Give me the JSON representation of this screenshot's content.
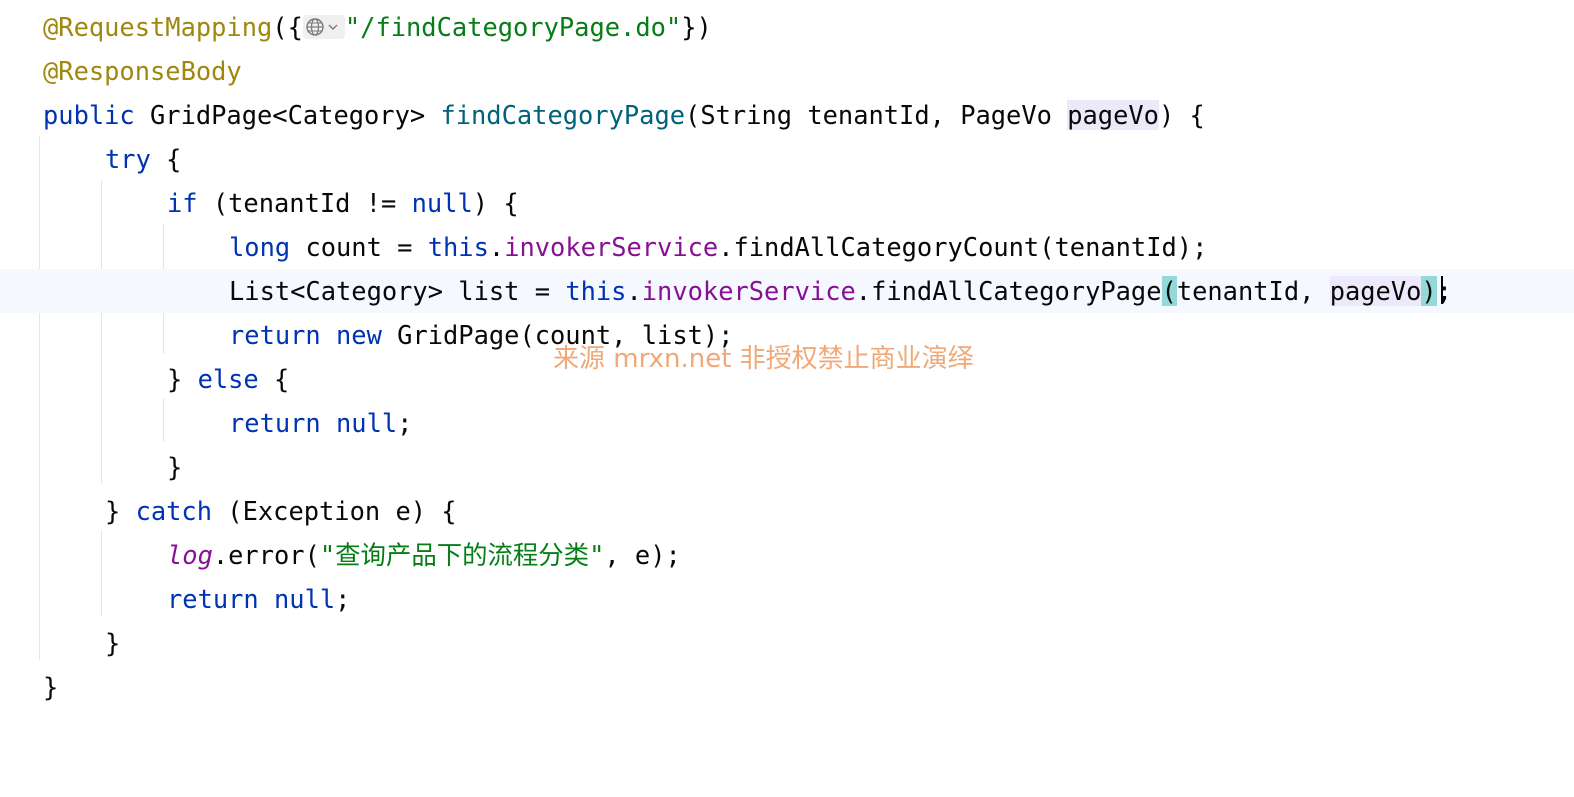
{
  "editor": {
    "lines": [
      {
        "a": "@RequestMapping",
        "b": "({",
        "c": "\"/findCategoryPage.do\"",
        "d": "})"
      },
      {
        "a": "@ResponseBody"
      },
      {
        "kw": "public",
        "b": " GridPage<Category> ",
        "fn": "findCategoryPage",
        "c": "(String tenantId, PageVo ",
        "hl": "pageVo",
        "d": ") {"
      },
      {
        "kw": "try",
        "b": " {"
      },
      {
        "kw": "if",
        "b": " (tenantId != ",
        "kw2": "null",
        "c": ") {"
      },
      {
        "kw": "long",
        "b": " count = ",
        "kw2": "this",
        "c": ".",
        "fld": "invokerService",
        "d": ".findAllCategoryCount(tenantId);"
      },
      {
        "a": "List<Category> list = ",
        "kw": "this",
        "b": ".",
        "fld": "invokerService",
        "c": ".findAllCategoryPage",
        "br1": "(",
        "d": "tenantId, ",
        "hl": "pageVo",
        "br2": ")",
        "e": ";"
      },
      {
        "kw": "return",
        "b": " ",
        "kw2": "new",
        "c": " GridPage(count, list);"
      },
      {
        "a": "} ",
        "kw": "else",
        "b": " {"
      },
      {
        "kw": "return",
        "b": " ",
        "kw2": "null",
        "c": ";"
      },
      {
        "a": "}"
      },
      {
        "a": "} ",
        "kw": "catch",
        "b": " (Exception e) {"
      },
      {
        "stat": "log",
        "a": ".error(",
        "str": "\"查询产品下的流程分类\"",
        "b": ", e);"
      },
      {
        "kw": "return",
        "b": " ",
        "kw2": "null",
        "c": ";"
      },
      {
        "a": "}"
      },
      {
        "a": "}"
      }
    ],
    "icons": {
      "web_endpoint": "globe-icon",
      "dropdown": "chevron-down-icon"
    }
  },
  "watermark": "来源 mrxn.net 非授权禁止商业演绎",
  "colors": {
    "keyword": "#0033b3",
    "annotation": "#9e880d",
    "string": "#067d17",
    "field": "#871094",
    "method_declaration": "#00627a",
    "current_line": "#f5f8fe",
    "brace_match": "#93d9d9",
    "identifier_highlight": "#ede9fb",
    "watermark": "#f0a878"
  }
}
